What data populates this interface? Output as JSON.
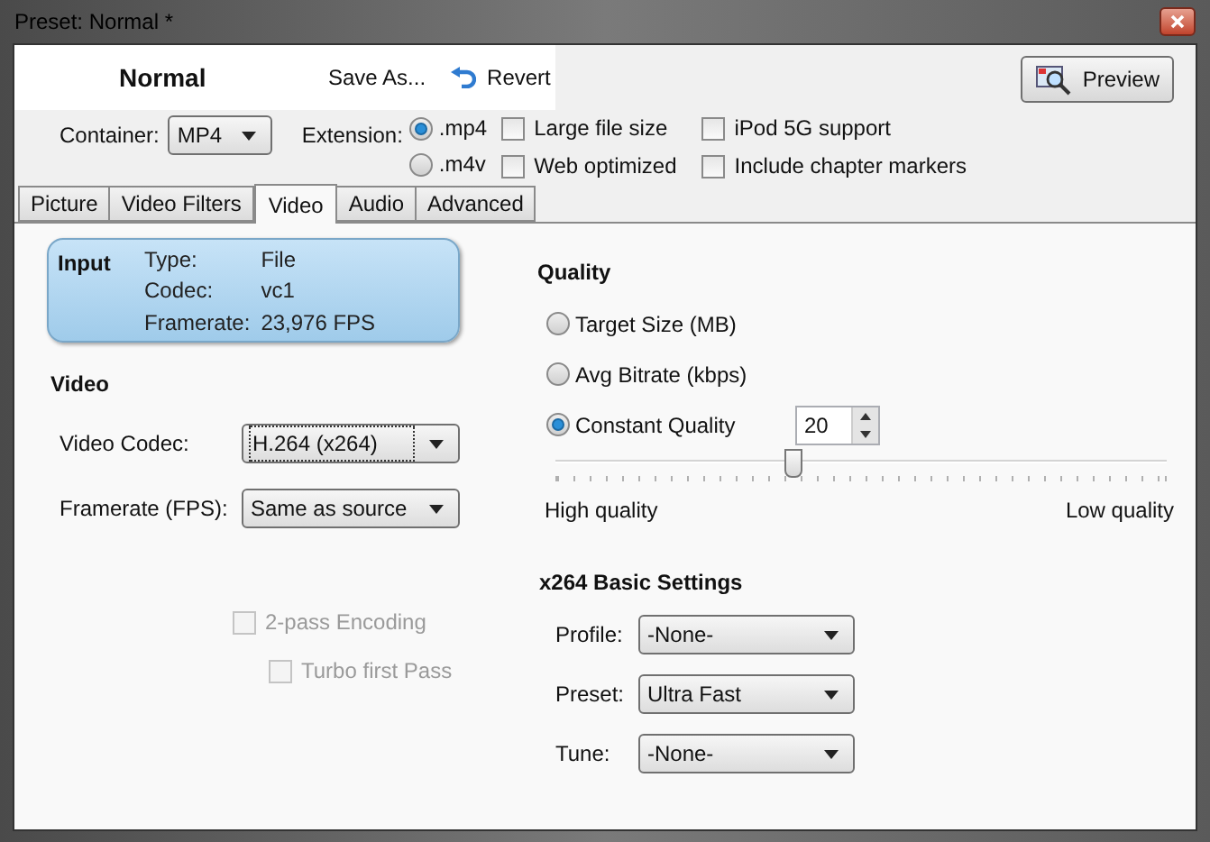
{
  "window": {
    "title": "Preset: Normal *"
  },
  "toolbar": {
    "preset_name": "Normal",
    "save_as": "Save As...",
    "revert": "Revert",
    "preview": "Preview"
  },
  "container": {
    "label": "Container:",
    "value": "MP4"
  },
  "extension": {
    "label": "Extension:",
    "options": [
      {
        "label": ".mp4",
        "selected": true
      },
      {
        "label": ".m4v",
        "selected": false
      }
    ]
  },
  "options": [
    {
      "label": "Large file size",
      "checked": false
    },
    {
      "label": "Web optimized",
      "checked": false
    },
    {
      "label": "iPod 5G support",
      "checked": false
    },
    {
      "label": "Include chapter markers",
      "checked": false
    }
  ],
  "tabs": [
    {
      "label": "Picture",
      "selected": false
    },
    {
      "label": "Video Filters",
      "selected": false
    },
    {
      "label": "Video",
      "selected": true
    },
    {
      "label": "Audio",
      "selected": false
    },
    {
      "label": "Advanced",
      "selected": false
    }
  ],
  "input": {
    "title": "Input",
    "rows": [
      {
        "label": "Type:",
        "value": "File"
      },
      {
        "label": "Codec:",
        "value": "vc1"
      },
      {
        "label": "Framerate:",
        "value": "23,976 FPS"
      }
    ]
  },
  "video": {
    "title": "Video",
    "fields": [
      {
        "label": "Video Codec:",
        "value": "H.264 (x264)",
        "focused": true
      },
      {
        "label": "Framerate (FPS):",
        "value": "Same as source",
        "focused": false
      }
    ],
    "two_pass": {
      "label": "2-pass Encoding",
      "checked": false,
      "disabled": true
    },
    "turbo": {
      "label": "Turbo first Pass",
      "checked": false,
      "disabled": true
    }
  },
  "quality": {
    "title": "Quality",
    "modes": [
      {
        "label": "Target Size (MB)",
        "selected": false
      },
      {
        "label": "Avg Bitrate (kbps)",
        "selected": false
      },
      {
        "label": "Constant Quality",
        "selected": true
      }
    ],
    "value": "20",
    "level": 0.39,
    "min_label": "High quality",
    "max_label": "Low quality"
  },
  "x264": {
    "title": "x264 Basic Settings",
    "fields": [
      {
        "label": "Profile:",
        "value": "-None-"
      },
      {
        "label": "Preset:",
        "value": "Ultra Fast"
      },
      {
        "label": "Tune:",
        "value": "-None-"
      }
    ]
  }
}
